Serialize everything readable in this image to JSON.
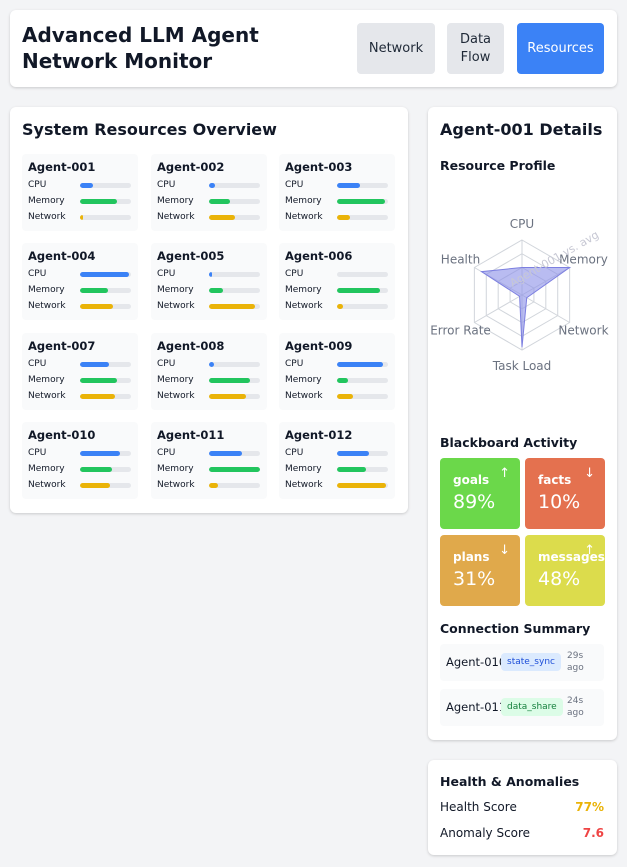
{
  "header": {
    "title": "Advanced LLM Agent Network Monitor",
    "nav": [
      {
        "label": "Network",
        "active": false
      },
      {
        "label": "Data Flow",
        "active": false
      },
      {
        "label": "Resources",
        "active": true
      }
    ]
  },
  "overview": {
    "title": "System Resources Overview",
    "metric_labels": {
      "cpu": "CPU",
      "memory": "Memory",
      "network": "Network"
    },
    "colors": {
      "cpu": "#3b82f6",
      "memory": "#22c55e",
      "network": "#eab308"
    },
    "agents": [
      {
        "name": "Agent-001",
        "cpu": 0.25,
        "memory": 0.72,
        "network": 0.05
      },
      {
        "name": "Agent-002",
        "cpu": 0.12,
        "memory": 0.42,
        "network": 0.5
      },
      {
        "name": "Agent-003",
        "cpu": 0.46,
        "memory": 0.94,
        "network": 0.25
      },
      {
        "name": "Agent-004",
        "cpu": 0.96,
        "memory": 0.54,
        "network": 0.65
      },
      {
        "name": "Agent-005",
        "cpu": 0.06,
        "memory": 0.27,
        "network": 0.9
      },
      {
        "name": "Agent-006",
        "cpu": 0.0,
        "memory": 0.85,
        "network": 0.12
      },
      {
        "name": "Agent-007",
        "cpu": 0.56,
        "memory": 0.73,
        "network": 0.69
      },
      {
        "name": "Agent-008",
        "cpu": 0.09,
        "memory": 0.81,
        "network": 0.72
      },
      {
        "name": "Agent-009",
        "cpu": 0.9,
        "memory": 0.21,
        "network": 0.31
      },
      {
        "name": "Agent-010",
        "cpu": 0.79,
        "memory": 0.62,
        "network": 0.59
      },
      {
        "name": "Agent-011",
        "cpu": 0.64,
        "memory": 1.0,
        "network": 0.17
      },
      {
        "name": "Agent-012",
        "cpu": 0.63,
        "memory": 0.56,
        "network": 0.97
      }
    ]
  },
  "details": {
    "title": "Agent-001 Details",
    "resource_profile": {
      "title": "Resource Profile",
      "axes": [
        "CPU",
        "Memory",
        "Network",
        "Task Load",
        "Error Rate",
        "Health"
      ],
      "values": [
        0.5,
        1.0,
        0.1,
        0.95,
        0.05,
        0.85
      ],
      "color": "#8b8fe8",
      "watermark": "Agent-001 vs. avg"
    },
    "blackboard": {
      "title": "Blackboard Activity",
      "tiles": [
        {
          "name": "goals",
          "pct": "89%",
          "arrow": "↑",
          "color": "#6bd84a"
        },
        {
          "name": "facts",
          "pct": "10%",
          "arrow": "↓",
          "color": "#e4714f"
        },
        {
          "name": "plans",
          "pct": "31%",
          "arrow": "↓",
          "color": "#e0a94b"
        },
        {
          "name": "messages",
          "pct": "48%",
          "arrow": "↑",
          "color": "#dcdc4c"
        }
      ]
    },
    "connections": {
      "title": "Connection Summary",
      "items": [
        {
          "agent": "Agent-010",
          "type": "state_sync",
          "time": "29s ago",
          "badge_bg": "#dbeafe",
          "badge_fg": "#1d4ed8"
        },
        {
          "agent": "Agent-011",
          "type": "data_share",
          "time": "24s ago",
          "badge_bg": "#dcfce7",
          "badge_fg": "#15803d"
        }
      ]
    }
  },
  "health": {
    "title": "Health & Anomalies",
    "rows": [
      {
        "label": "Health Score",
        "value": "77%",
        "color": "#eab308"
      },
      {
        "label": "Anomaly Score",
        "value": "7.6",
        "color": "#ef4444"
      }
    ]
  }
}
